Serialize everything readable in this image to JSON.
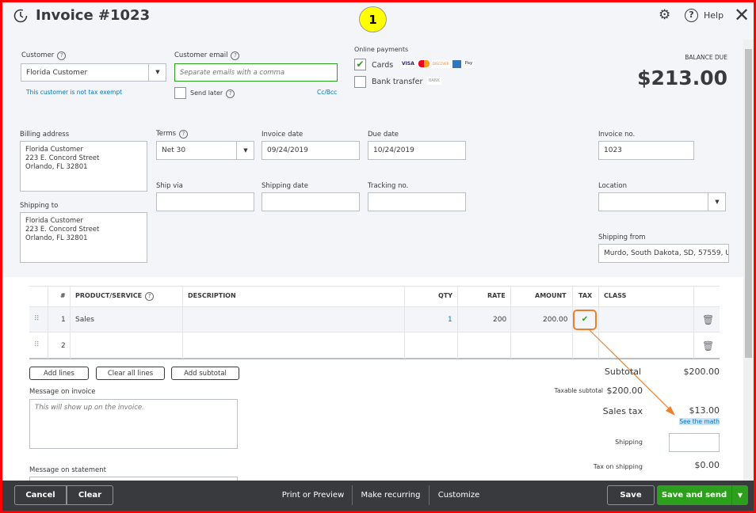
{
  "header": {
    "title": "Invoice #1023",
    "help": "Help",
    "step_badge": "1"
  },
  "customer": {
    "label": "Customer",
    "value": "Florida Customer",
    "tax_note": "This customer is not tax exempt"
  },
  "email": {
    "label": "Customer email",
    "placeholder": "Separate emails with a comma",
    "send_later": "Send later",
    "cc_bcc": "Cc/Bcc"
  },
  "online_payments": {
    "label": "Online payments",
    "cards": "Cards",
    "cards_checked": true,
    "card_logos": [
      "VISA",
      "MC",
      "DISCOVER",
      "AMEX",
      "Pay"
    ],
    "bank": "Bank transfer",
    "bank_logo": "BANK"
  },
  "balance": {
    "label": "BALANCE DUE",
    "amount": "$213.00"
  },
  "billing": {
    "label": "Billing address",
    "lines": [
      "Florida Customer",
      "223 E. Concord Street",
      "Orlando, FL  32801"
    ]
  },
  "shipping_to": {
    "label": "Shipping to",
    "lines": [
      "Florida Customer",
      "223 E. Concord Street",
      "Orlando, FL  32801"
    ]
  },
  "terms": {
    "label": "Terms",
    "value": "Net 30"
  },
  "invoice_date": {
    "label": "Invoice date",
    "value": "09/24/2019"
  },
  "due_date": {
    "label": "Due date",
    "value": "10/24/2019"
  },
  "invoice_no": {
    "label": "Invoice no.",
    "value": "1023"
  },
  "ship_via": {
    "label": "Ship via",
    "value": ""
  },
  "shipping_date": {
    "label": "Shipping date",
    "value": ""
  },
  "tracking_no": {
    "label": "Tracking no.",
    "value": ""
  },
  "location": {
    "label": "Location",
    "value": ""
  },
  "shipping_from": {
    "label": "Shipping from",
    "value": "Murdo, South Dakota, SD, 57559, U"
  },
  "table": {
    "headers": [
      "#",
      "PRODUCT/SERVICE",
      "DESCRIPTION",
      "QTY",
      "RATE",
      "AMOUNT",
      "TAX",
      "CLASS"
    ],
    "rows": [
      {
        "num": "1",
        "product": "Sales",
        "description": "",
        "qty": "1",
        "rate": "200",
        "amount": "200.00",
        "tax": true,
        "class": ""
      },
      {
        "num": "2",
        "product": "",
        "description": "",
        "qty": "",
        "rate": "",
        "amount": "",
        "tax": false,
        "class": ""
      }
    ]
  },
  "table_buttons": {
    "add_lines": "Add lines",
    "clear_all": "Clear all lines",
    "add_subtotal": "Add subtotal"
  },
  "message_invoice": {
    "label": "Message on invoice",
    "placeholder": "This will show up on the invoice."
  },
  "message_statement": {
    "label": "Message on statement"
  },
  "totals": {
    "subtotal_label": "Subtotal",
    "subtotal": "$200.00",
    "taxable_label": "Taxable subtotal",
    "taxable": "$200.00",
    "sales_tax_label": "Sales tax",
    "sales_tax": "$13.00",
    "see_math": "See the math",
    "shipping_label": "Shipping",
    "tax_shipping_label": "Tax on shipping",
    "tax_shipping": "$0.00"
  },
  "footer": {
    "cancel": "Cancel",
    "clear": "Clear",
    "print": "Print or Preview",
    "recurring": "Make recurring",
    "customize": "Customize",
    "save": "Save",
    "save_send": "Save and send"
  },
  "colors": {
    "green": "#2ca01c",
    "annotation": "#f07f2a",
    "link": "#0077c5"
  }
}
